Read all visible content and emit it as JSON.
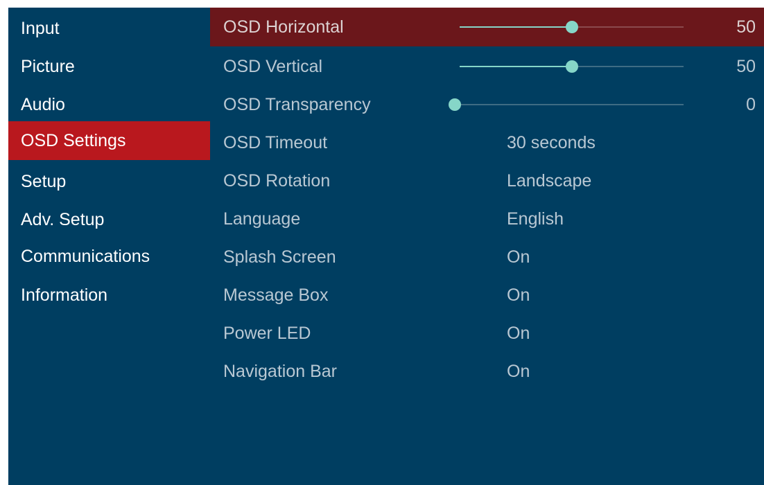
{
  "colors": {
    "background": "#003e61",
    "active_menu": "#b9181e",
    "selected_row": "#6b171b",
    "slider_accent": "#86d6c8",
    "text_primary": "#ffffff",
    "text_secondary": "#b9c8d3"
  },
  "menu": {
    "items": [
      {
        "label": "Input",
        "active": false
      },
      {
        "label": "Picture",
        "active": false
      },
      {
        "label": "Audio",
        "active": false
      },
      {
        "label": "OSD Settings",
        "active": true
      },
      {
        "label": "Setup",
        "active": false
      },
      {
        "label": "Adv. Setup",
        "active": false
      },
      {
        "label": "Communications",
        "active": false
      },
      {
        "label": "Information",
        "active": false
      }
    ]
  },
  "settings": {
    "rows": [
      {
        "label": "OSD Horizontal",
        "type": "slider",
        "value": 50,
        "value_text": "50",
        "selected": true
      },
      {
        "label": "OSD Vertical",
        "type": "slider",
        "value": 50,
        "value_text": "50",
        "selected": false
      },
      {
        "label": "OSD Transparency",
        "type": "slider",
        "value": 0,
        "value_text": "0",
        "selected": false
      },
      {
        "label": "OSD Timeout",
        "type": "option",
        "value_text": "30 seconds",
        "selected": false
      },
      {
        "label": "OSD Rotation",
        "type": "option",
        "value_text": "Landscape",
        "selected": false
      },
      {
        "label": "Language",
        "type": "option",
        "value_text": "English",
        "selected": false
      },
      {
        "label": "Splash Screen",
        "type": "option",
        "value_text": "On",
        "selected": false
      },
      {
        "label": "Message Box",
        "type": "option",
        "value_text": "On",
        "selected": false
      },
      {
        "label": "Power LED",
        "type": "option",
        "value_text": "On",
        "selected": false
      },
      {
        "label": "Navigation Bar",
        "type": "option",
        "value_text": "On",
        "selected": false
      }
    ]
  }
}
